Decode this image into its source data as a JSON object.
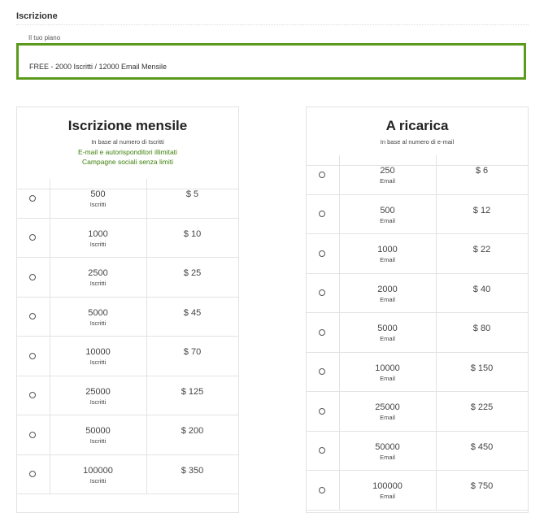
{
  "page": {
    "section_title": "Iscrizione",
    "plan_label": "Il tuo piano",
    "plan_value": "FREE - 2000 Iscritti / 12000 Email Mensile"
  },
  "monthly": {
    "title": "Iscrizione mensile",
    "subtitle": "In base al numero di Iscritti",
    "features": [
      "E-mail e autorisponditori illimitati",
      "Campagne sociali senza limiti"
    ],
    "rows": [
      {
        "qty": "500",
        "unit": "Iscritti",
        "price": "$ 5"
      },
      {
        "qty": "1000",
        "unit": "Iscritti",
        "price": "$ 10"
      },
      {
        "qty": "2500",
        "unit": "Iscritti",
        "price": "$ 25"
      },
      {
        "qty": "5000",
        "unit": "Iscritti",
        "price": "$ 45"
      },
      {
        "qty": "10000",
        "unit": "Iscritti",
        "price": "$ 70"
      },
      {
        "qty": "25000",
        "unit": "Iscritti",
        "price": "$ 125"
      },
      {
        "qty": "50000",
        "unit": "Iscritti",
        "price": "$ 200"
      },
      {
        "qty": "100000",
        "unit": "Iscritti",
        "price": "$ 350"
      }
    ]
  },
  "recharge": {
    "title": "A ricarica",
    "subtitle": "In base al numero di e-mail",
    "rows": [
      {
        "qty": "250",
        "unit": "Email",
        "price": "$ 6"
      },
      {
        "qty": "500",
        "unit": "Email",
        "price": "$ 12"
      },
      {
        "qty": "1000",
        "unit": "Email",
        "price": "$ 22"
      },
      {
        "qty": "2000",
        "unit": "Email",
        "price": "$ 40"
      },
      {
        "qty": "5000",
        "unit": "Email",
        "price": "$ 80"
      },
      {
        "qty": "10000",
        "unit": "Email",
        "price": "$ 150"
      },
      {
        "qty": "25000",
        "unit": "Email",
        "price": "$ 225"
      },
      {
        "qty": "50000",
        "unit": "Email",
        "price": "$ 450"
      },
      {
        "qty": "100000",
        "unit": "Email",
        "price": "$ 750"
      }
    ]
  },
  "colors": {
    "accent_green": "#5b9a1d",
    "feature_text": "#3d7f0a",
    "border": "#e3e3e3"
  }
}
